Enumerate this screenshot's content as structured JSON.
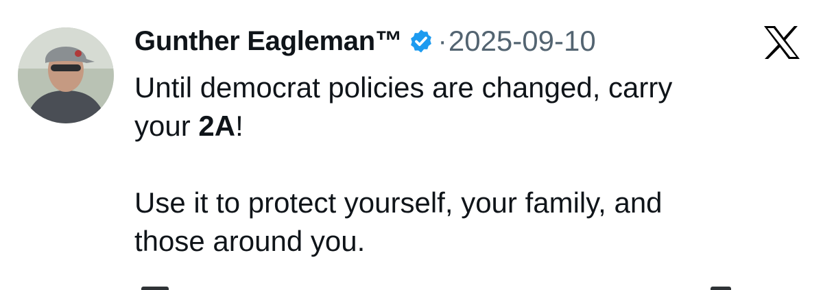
{
  "author": {
    "display_name": "Gunther Eagleman™",
    "verified": true,
    "separator": "·",
    "date": "2025-09-10"
  },
  "icons": {
    "avatar": "profile-photo",
    "verified": "verified-badge-icon",
    "platform": "x-logo-icon"
  },
  "colors": {
    "text": "#0f1419",
    "secondary": "#536471",
    "verified_blue": "#1d9bf0"
  },
  "tweet": {
    "line1": "Until democrat policies are changed,  carry",
    "line2_prefix": "your ",
    "line2_bold": "2A",
    "line2_suffix": "!",
    "line3": "Use it to protect yourself, your family, and",
    "line4": "those around you."
  }
}
